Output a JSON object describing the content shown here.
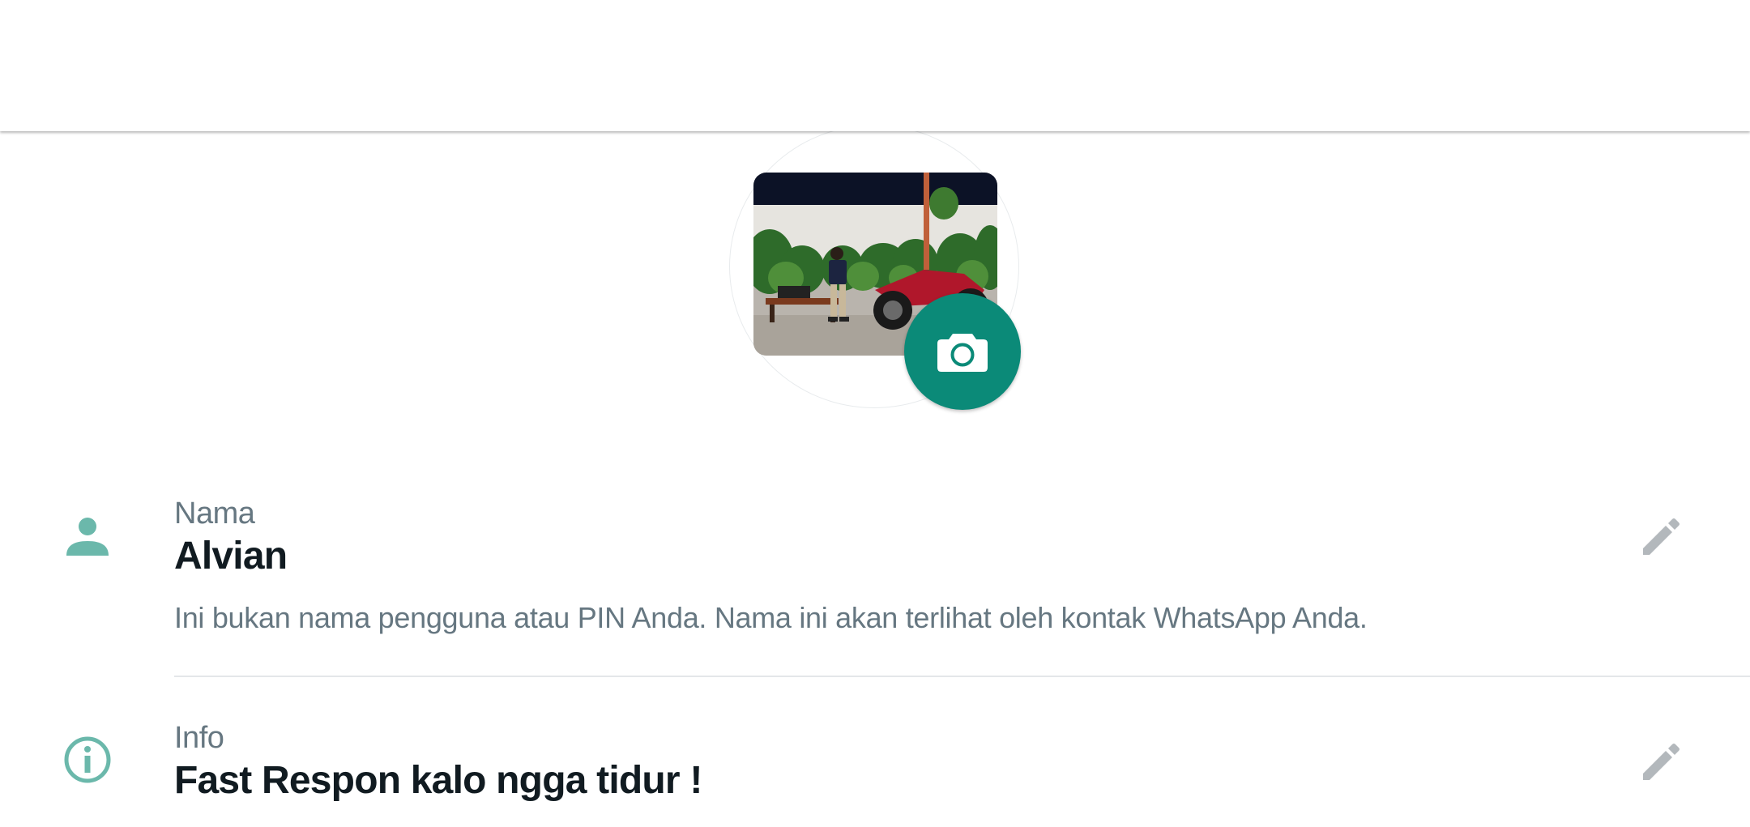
{
  "profile": {
    "photo_alt": "Foto profil",
    "camera_button_icon": "camera-icon"
  },
  "name_row": {
    "icon": "person-icon",
    "label": "Nama",
    "value": "Alvian",
    "hint": "Ini bukan nama pengguna atau PIN Anda. Nama ini akan terlihat oleh kontak WhatsApp Anda.",
    "edit_icon": "pencil-icon"
  },
  "info_row": {
    "icon": "info-icon",
    "label": "Info",
    "value": "Fast Respon kalo ngga tidur !",
    "edit_icon": "pencil-icon"
  },
  "colors": {
    "accent": "#0b8a78",
    "icon_teal": "#6bb8ab",
    "primary_text": "#111b21",
    "secondary_text": "#667781",
    "edit_icon_gray": "#b3b8bc"
  }
}
